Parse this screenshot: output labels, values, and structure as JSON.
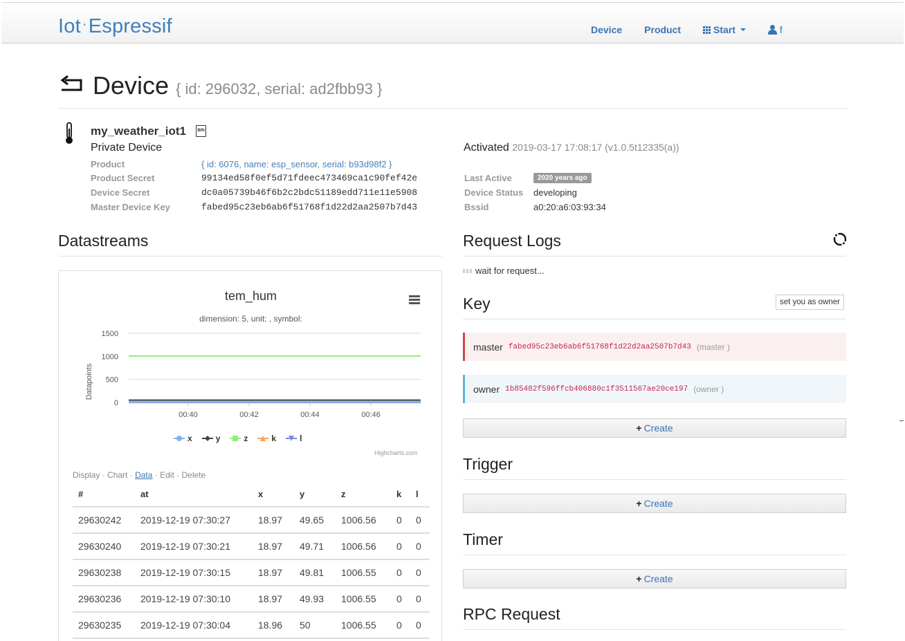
{
  "navbar": {
    "brand_part1": "Iot",
    "brand_sep": "·",
    "brand_part2": "Espressif",
    "device": "Device",
    "product": "Product",
    "start": "Start",
    "user": "f"
  },
  "header": {
    "title": "Device",
    "subtitle": "{ id: 296032, serial: ad2fbb93 }"
  },
  "device": {
    "name": "my_weather_iot1",
    "bin_label": "BIN",
    "type": "Private Device",
    "fields": [
      {
        "label": "Product",
        "value": "{ id: 6076, name: esp_sensor, serial: b93d98f2 }"
      },
      {
        "label": "Product Secret",
        "value": "99134ed58f0ef5d71fdeec473469ca1c90fef42e"
      },
      {
        "label": "Device Secret",
        "value": "dc0a05739b46f6b2c2bdc51189edd711e11e5908"
      },
      {
        "label": "Master Device Key",
        "value": "fabed95c23eb6ab6f51768f1d22d2aa2507b7d43"
      }
    ],
    "activated_label": "Activated",
    "activated_meta": "2019-03-17 17:08:17 (v1.0.5t12335(a))",
    "status": [
      {
        "label": "Last Active",
        "value": "2020 years ago"
      },
      {
        "label": "Device Status",
        "value": "developing"
      },
      {
        "label": "Bssid",
        "value": "a0:20:a6:03:93:34"
      }
    ]
  },
  "datastreams": {
    "heading": "Datastreams",
    "tabs": {
      "display": "Display",
      "chart": "Chart",
      "data": "Data",
      "edit": "Edit",
      "delete": "Delete",
      "sep": "·"
    },
    "table": {
      "headers": [
        "#",
        "at",
        "x",
        "y",
        "z",
        "k",
        "l"
      ],
      "rows": [
        [
          "29630242",
          "2019-12-19 07:30:27",
          "18.97",
          "49.65",
          "1006.56",
          "0",
          "0"
        ],
        [
          "29630240",
          "2019-12-19 07:30:21",
          "18.97",
          "49.71",
          "1006.56",
          "0",
          "0"
        ],
        [
          "29630238",
          "2019-12-19 07:30:15",
          "18.97",
          "49.81",
          "1006.55",
          "0",
          "0"
        ],
        [
          "29630236",
          "2019-12-19 07:30:10",
          "18.97",
          "49.93",
          "1006.55",
          "0",
          "0"
        ],
        [
          "29630235",
          "2019-12-19 07:30:04",
          "18.96",
          "50",
          "1006.55",
          "0",
          "0"
        ]
      ]
    }
  },
  "chart_data": {
    "type": "line",
    "title": "tem_hum",
    "subtitle": "dimension: 5, unit: , symbol:",
    "ylabel": "Datapoints",
    "xlabel": "",
    "yticks": [
      0,
      500,
      1000,
      1500
    ],
    "ylim": [
      0,
      1500
    ],
    "xticks": [
      "00:40",
      "00:42",
      "00:44",
      "00:46"
    ],
    "legend_position": "bottom",
    "grid": true,
    "credit": "Highcharts.com",
    "series": [
      {
        "name": "x",
        "color": "#7cb5ec",
        "level": 19
      },
      {
        "name": "y",
        "color": "#434348",
        "level": 50
      },
      {
        "name": "z",
        "color": "#90ed7d",
        "level": 1006
      },
      {
        "name": "k",
        "color": "#f7a35c",
        "level": 0
      },
      {
        "name": "l",
        "color": "#8085e9",
        "level": 0
      }
    ]
  },
  "request_logs": {
    "heading": "Request Logs",
    "wait_text": "wait for request..."
  },
  "key": {
    "heading": "Key",
    "owner_button": "set you as owner",
    "master": {
      "label": "master",
      "code": "fabed95c23eb6ab6f51768f1d22d2aa2507b7d43",
      "role": "(master )"
    },
    "owner": {
      "label": "owner",
      "code": "1b85482f596ffcb406880c1f3511567ae20ce197",
      "role": "(owner )"
    },
    "create": "Create"
  },
  "trigger": {
    "heading": "Trigger",
    "create": "Create"
  },
  "timer": {
    "heading": "Timer",
    "create": "Create"
  },
  "rpc": {
    "heading": "RPC Request"
  },
  "colors": {
    "brand": "#3f7fbf",
    "link": "#3a73b3",
    "master_border": "#c9474a",
    "owner_border": "#5bb4d8"
  }
}
